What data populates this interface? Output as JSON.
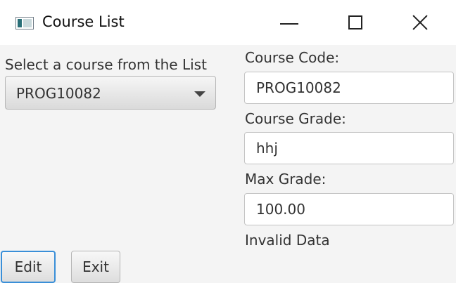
{
  "window": {
    "title": "Course List",
    "icon": "app-window-icon",
    "controls": [
      "minimize-icon",
      "maximize-icon",
      "close-icon"
    ]
  },
  "left": {
    "select_label": "Select a course from the List",
    "combo_value": "PROG10082"
  },
  "right": {
    "code_label": "Course Code:",
    "code_value": "PROG10082",
    "grade_label": "Course Grade:",
    "grade_value": "hhj",
    "max_label": "Max Grade:",
    "max_value": "100.00",
    "status_text": "Invalid Data"
  },
  "buttons": {
    "edit_label": "Edit",
    "exit_label": "Exit"
  },
  "colors": {
    "focus_accent": "#3a8fd8",
    "window_background": "#f4f4f4"
  }
}
